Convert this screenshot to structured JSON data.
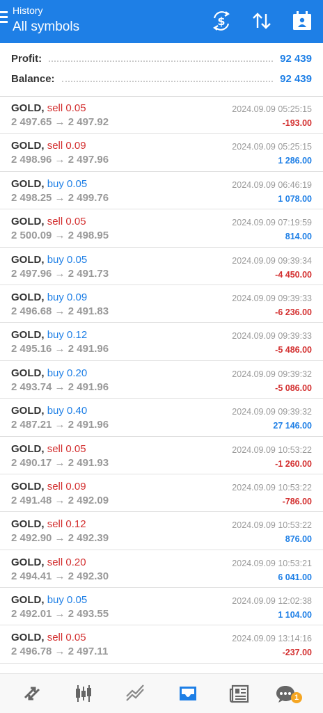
{
  "header": {
    "subtitle": "History",
    "title": "All symbols"
  },
  "toolbar_icons": [
    "currency-exchange-icon",
    "sort-icon",
    "calendar-icon"
  ],
  "summary": {
    "profit_label": "Profit:",
    "profit_value": "92 439",
    "balance_label": "Balance:",
    "balance_value": "92 439"
  },
  "trades": [
    {
      "symbol": "GOLD",
      "side": "sell",
      "volume": "0.05",
      "prices": "2 497.65 → 2 497.92",
      "time": "2024.09.09 05:25:15",
      "profit": "-193.00"
    },
    {
      "symbol": "GOLD",
      "side": "sell",
      "volume": "0.09",
      "prices": "2 498.96 → 2 497.96",
      "time": "2024.09.09 05:25:15",
      "profit": "1 286.00"
    },
    {
      "symbol": "GOLD",
      "side": "buy",
      "volume": "0.05",
      "prices": "2 498.25 → 2 499.76",
      "time": "2024.09.09 06:46:19",
      "profit": "1 078.00"
    },
    {
      "symbol": "GOLD",
      "side": "sell",
      "volume": "0.05",
      "prices": "2 500.09 → 2 498.95",
      "time": "2024.09.09 07:19:59",
      "profit": "814.00"
    },
    {
      "symbol": "GOLD",
      "side": "buy",
      "volume": "0.05",
      "prices": "2 497.96 → 2 491.73",
      "time": "2024.09.09 09:39:34",
      "profit": "-4 450.00"
    },
    {
      "symbol": "GOLD",
      "side": "buy",
      "volume": "0.09",
      "prices": "2 496.68 → 2 491.83",
      "time": "2024.09.09 09:39:33",
      "profit": "-6 236.00"
    },
    {
      "symbol": "GOLD",
      "side": "buy",
      "volume": "0.12",
      "prices": "2 495.16 → 2 491.96",
      "time": "2024.09.09 09:39:33",
      "profit": "-5 486.00"
    },
    {
      "symbol": "GOLD",
      "side": "buy",
      "volume": "0.20",
      "prices": "2 493.74 → 2 491.96",
      "time": "2024.09.09 09:39:32",
      "profit": "-5 086.00"
    },
    {
      "symbol": "GOLD",
      "side": "buy",
      "volume": "0.40",
      "prices": "2 487.21 → 2 491.96",
      "time": "2024.09.09 09:39:32",
      "profit": "27 146.00"
    },
    {
      "symbol": "GOLD",
      "side": "sell",
      "volume": "0.05",
      "prices": "2 490.17 → 2 491.93",
      "time": "2024.09.09 10:53:22",
      "profit": "-1 260.00"
    },
    {
      "symbol": "GOLD",
      "side": "sell",
      "volume": "0.09",
      "prices": "2 491.48 → 2 492.09",
      "time": "2024.09.09 10:53:22",
      "profit": "-786.00"
    },
    {
      "symbol": "GOLD",
      "side": "sell",
      "volume": "0.12",
      "prices": "2 492.90 → 2 492.39",
      "time": "2024.09.09 10:53:22",
      "profit": "876.00"
    },
    {
      "symbol": "GOLD",
      "side": "sell",
      "volume": "0.20",
      "prices": "2 494.41 → 2 492.30",
      "time": "2024.09.09 10:53:21",
      "profit": "6 041.00"
    },
    {
      "symbol": "GOLD",
      "side": "buy",
      "volume": "0.05",
      "prices": "2 492.01 → 2 493.55",
      "time": "2024.09.09 12:02:38",
      "profit": "1 104.00"
    },
    {
      "symbol": "GOLD",
      "side": "sell",
      "volume": "0.05",
      "prices": "2 496.78 → 2 497.11",
      "time": "2024.09.09 13:14:16",
      "profit": "-237.00"
    }
  ],
  "bottom_nav": {
    "items": [
      "quotes-icon",
      "chart-icon",
      "trade-icon",
      "history-icon",
      "news-icon",
      "messages-icon"
    ],
    "active": "history-icon",
    "messages_badge": "1"
  },
  "colors": {
    "accent": "#1e7fe6",
    "sell": "#d32f2f",
    "buy": "#1e7fe6",
    "muted": "#999999",
    "badge": "#f5a623"
  }
}
